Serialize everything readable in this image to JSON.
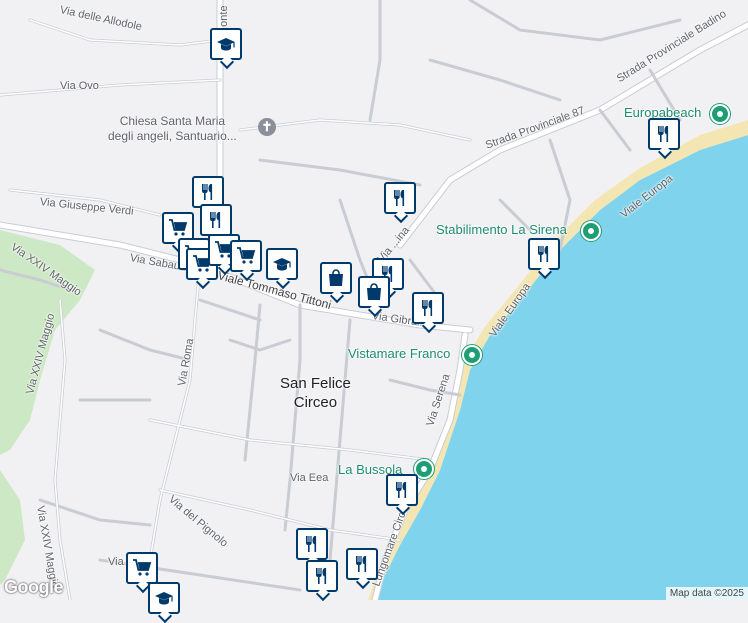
{
  "map": {
    "colors": {
      "land": "#f1f1f4",
      "water": "#7fd3ec",
      "beach": "#f3e6b3",
      "green": "#cde8c4",
      "road": "#ffffff",
      "road_outline": "#c9ccd3",
      "marker_border": "#003a6b",
      "poi_green": "#1e8e6e"
    },
    "places": {
      "town": "San Felice\nCirceo",
      "church": "Chiesa Santa Maria\ndegli angeli, Santuario..."
    },
    "street_labels": [
      "Via delle Allodole",
      "Via Ovo",
      "Via Giuseppe Verdi",
      "Via Sabaudia",
      "Viale Tommaso Tittoni",
      "Via Roma",
      "Via XXIV Maggio",
      "Via XXIV Maggio",
      "Via XXIV Maggio",
      "Via Eea",
      "Via del Pignolo",
      "Strada Provinciale 87",
      "Strada Provinciale Badino",
      "Viale Europa",
      "Viale Europa",
      "Via Serena",
      "Lungomare Circeo",
      "Via Gibral...",
      "Via ...ina",
      "...onte",
      "Via"
    ],
    "pois": [
      "Europabeach",
      "Stabilimento La Sirena",
      "Vistamare Franco",
      "La Bussola"
    ],
    "markers": [
      {
        "icon": "school-icon"
      },
      {
        "icon": "restaurant-icon"
      },
      {
        "icon": "restaurant-icon"
      },
      {
        "icon": "shopping-cart-icon"
      },
      {
        "icon": "shopping-cart-icon"
      },
      {
        "icon": "shopping-cart-icon"
      },
      {
        "icon": "shopping-cart-icon"
      },
      {
        "icon": "shopping-cart-icon"
      },
      {
        "icon": "school-icon"
      },
      {
        "icon": "restaurant-icon"
      },
      {
        "icon": "restaurant-icon"
      },
      {
        "icon": "shopping-bag-icon"
      },
      {
        "icon": "shopping-bag-icon"
      },
      {
        "icon": "restaurant-icon"
      },
      {
        "icon": "restaurant-icon"
      },
      {
        "icon": "restaurant-icon"
      },
      {
        "icon": "restaurant-icon"
      },
      {
        "icon": "restaurant-icon"
      },
      {
        "icon": "restaurant-icon"
      },
      {
        "icon": "restaurant-icon"
      },
      {
        "icon": "shopping-cart-icon"
      },
      {
        "icon": "school-icon"
      }
    ],
    "logo": "Google",
    "attribution": "Map data ©2025"
  }
}
